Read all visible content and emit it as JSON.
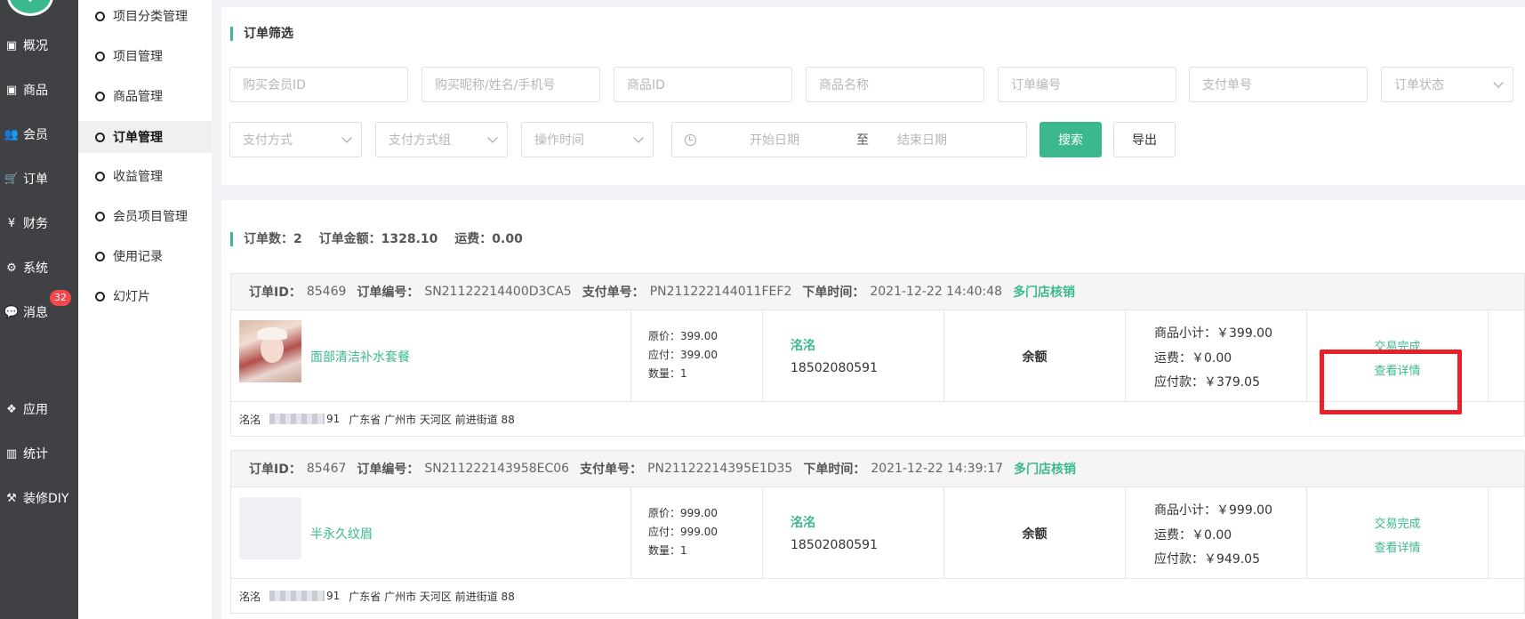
{
  "nav": {
    "items": [
      {
        "icon": "archive-icon",
        "glyph": "▣",
        "label": "概况"
      },
      {
        "icon": "archive-icon",
        "glyph": "▣",
        "label": "商品"
      },
      {
        "icon": "users-icon",
        "glyph": "👥",
        "label": "会员"
      },
      {
        "icon": "cart-icon",
        "glyph": "🛒",
        "label": "订单"
      },
      {
        "icon": "yen-icon",
        "glyph": "¥",
        "label": "财务"
      },
      {
        "icon": "gears-icon",
        "glyph": "⚙",
        "label": "系统"
      },
      {
        "icon": "comment-icon",
        "glyph": "💬",
        "label": "消息"
      },
      {
        "icon": "cubes-icon",
        "glyph": "❖",
        "label": "应用"
      },
      {
        "icon": "bar-chart-icon",
        "glyph": "▥",
        "label": "统计"
      },
      {
        "icon": "hammer-icon",
        "glyph": "⚒",
        "label": "装修DIY"
      }
    ],
    "badge": "32"
  },
  "subnav": {
    "items": [
      "项目分类管理",
      "项目管理",
      "商品管理",
      "订单管理",
      "收益管理",
      "会员项目管理",
      "使用记录",
      "幻灯片"
    ],
    "active": "订单管理"
  },
  "filter": {
    "title": "订单筛选",
    "placeholders": [
      "购买会员ID",
      "购买昵称/姓名/手机号",
      "商品ID",
      "商品名称",
      "订单编号",
      "支付单号"
    ],
    "selects": [
      "订单状态",
      "支付方式",
      "支付方式组",
      "操作时间"
    ],
    "date_start": "开始日期",
    "date_sep": "至",
    "date_end": "结束日期",
    "search_label": "搜索",
    "export_label": "导出"
  },
  "summary": {
    "count": "订单数：2",
    "amount": "订单金额：1328.10",
    "freight": "运费：0.00"
  },
  "orders": [
    {
      "id_label": "订单ID：",
      "id": "85469",
      "sn_label": "订单编号：",
      "sn": "SN21122214400D3CA5",
      "pay_label": "支付单号：",
      "pay_no": "PN211222144011FEF2",
      "time_label": "下单时间：",
      "time": "2021-12-22 14:40:48",
      "tag": "多门店核销",
      "goods": "面部清洁补水套餐",
      "price_original": "原价：399.00",
      "price_pay": "应付：399.00",
      "quantity": "数量：1",
      "buyer": "洺洺",
      "phone": "18502080591",
      "pay_type": "余额",
      "subtotal": "商品小计：￥399.00",
      "freight": "运费：￥0.00",
      "payable": "应付款：￥379.05",
      "status": "交易完成",
      "detail": "查看详情",
      "addr_name": "洺洺",
      "addr_tail": "91",
      "address": "广东省 广州市 天河区 前进街道 88"
    },
    {
      "id_label": "订单ID：",
      "id": "85467",
      "sn_label": "订单编号：",
      "sn": "SN211222143958EC06",
      "pay_label": "支付单号：",
      "pay_no": "PN21122214395E1D35",
      "time_label": "下单时间：",
      "time": "2021-12-22 14:39:17",
      "tag": "多门店核销",
      "goods": "半永久纹眉",
      "price_original": "原价：999.00",
      "price_pay": "应付：999.00",
      "quantity": "数量：1",
      "buyer": "洺洺",
      "phone": "18502080591",
      "pay_type": "余额",
      "subtotal": "商品小计：￥999.00",
      "freight": "运费：￥0.00",
      "payable": "应付款：￥949.05",
      "status": "交易完成",
      "detail": "查看详情",
      "addr_name": "洺洺",
      "addr_tail": "91",
      "address": "广东省 广州市 天河区 前进街道 88"
    }
  ],
  "colors": {
    "accent": "#3bb98d",
    "sidebar": "#404144",
    "badge": "#f5474c",
    "highlight": "#e8202a"
  }
}
